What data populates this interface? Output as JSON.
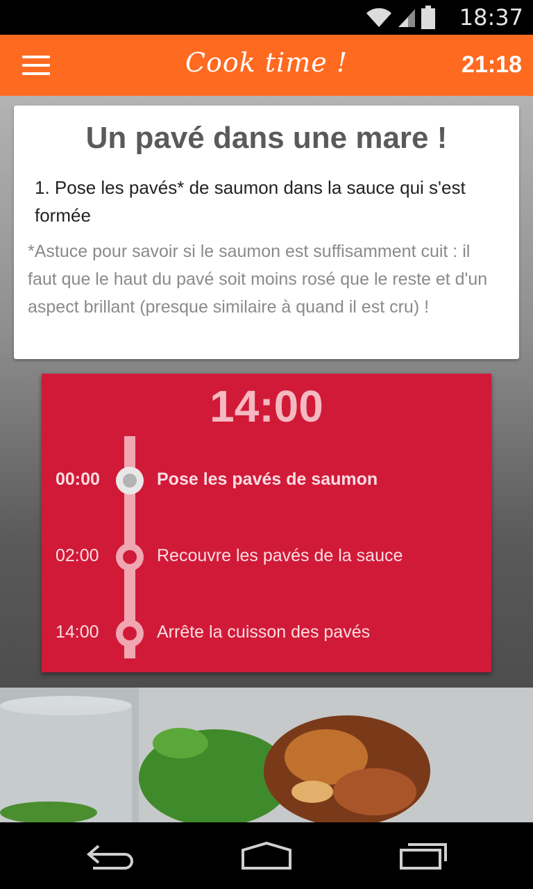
{
  "status_bar": {
    "time": "18:37"
  },
  "app_bar": {
    "title": "Cook time !",
    "clock": "21:18"
  },
  "recipe_card": {
    "title": "Un pavé dans une mare !",
    "step": "1. Pose les pavés* de saumon dans la sauce qui s'est formée",
    "tip": "*Astuce pour savoir si le saumon est suffisamment cuit : il faut que le haut du pavé soit moins rosé que le reste et d'un aspect brillant (presque similaire à quand il est cru) !"
  },
  "timer": {
    "countdown": "14:00",
    "steps": [
      {
        "time": "00:00",
        "label": "Pose les pavés de saumon",
        "active": true
      },
      {
        "time": "02:00",
        "label": "Recouvre les pavés de la sauce",
        "active": false
      },
      {
        "time": "14:00",
        "label": "Arrête la cuisson des pavés",
        "active": false
      }
    ]
  },
  "colors": {
    "app_bar": "#ff6a21",
    "timer_bg": "#d11a38",
    "timeline": "#f0a7b2"
  },
  "icons": [
    "wifi-icon",
    "signal-icon",
    "battery-icon",
    "menu-icon",
    "back-icon",
    "home-icon",
    "recent-apps-icon"
  ]
}
